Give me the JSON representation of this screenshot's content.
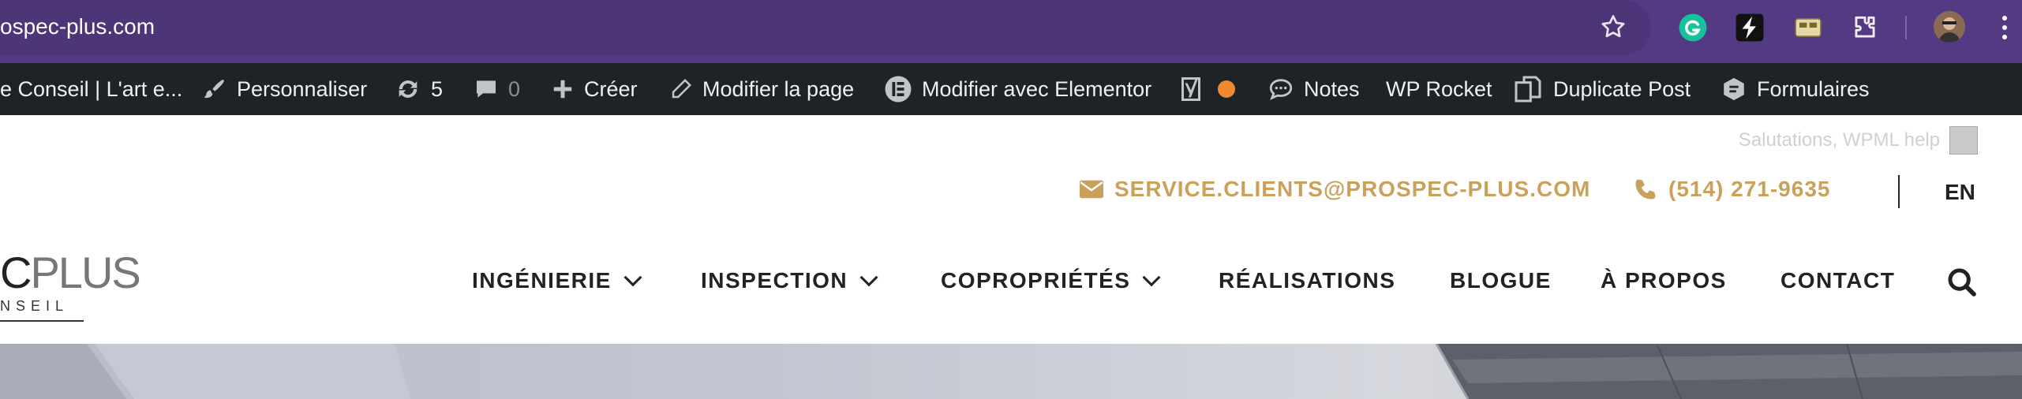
{
  "browser": {
    "url": "ospec-plus.com",
    "icons": [
      "star-icon",
      "grammarly-icon",
      "lightning-extension-icon",
      "tab-extension-icon",
      "puzzle-extensions-icon",
      "profile-avatar",
      "more-menu-icon"
    ]
  },
  "adminbar": {
    "site": "e Conseil | L'art e...",
    "customize": "Personnaliser",
    "updates": "5",
    "comments": "0",
    "new": "Créer",
    "edit_page": "Modifier la page",
    "elementor": "Modifier avec Elementor",
    "notes": "Notes",
    "wp_rocket": "WP Rocket",
    "duplicate": "Duplicate Post",
    "forms": "Formulaires",
    "seo_dot_color": "#f08a2e"
  },
  "header": {
    "greeting": "Salutations, WPML help",
    "email": "SERVICE.CLIENTS@PROSPEC-PLUS.COM",
    "phone": "(514) 271-9635",
    "lang": "EN",
    "accent_color": "#c9a15a"
  },
  "logo": {
    "big_a": "C",
    "big_b": "PLUS",
    "small": "NSEIL"
  },
  "nav": {
    "engineering": "INGÉNIERIE",
    "inspection": "INSPECTION",
    "condos": "COPROPRIÉTÉS",
    "projects": "RÉALISATIONS",
    "blog": "BLOGUE",
    "about": "À PROPOS",
    "contact": "CONTACT"
  }
}
